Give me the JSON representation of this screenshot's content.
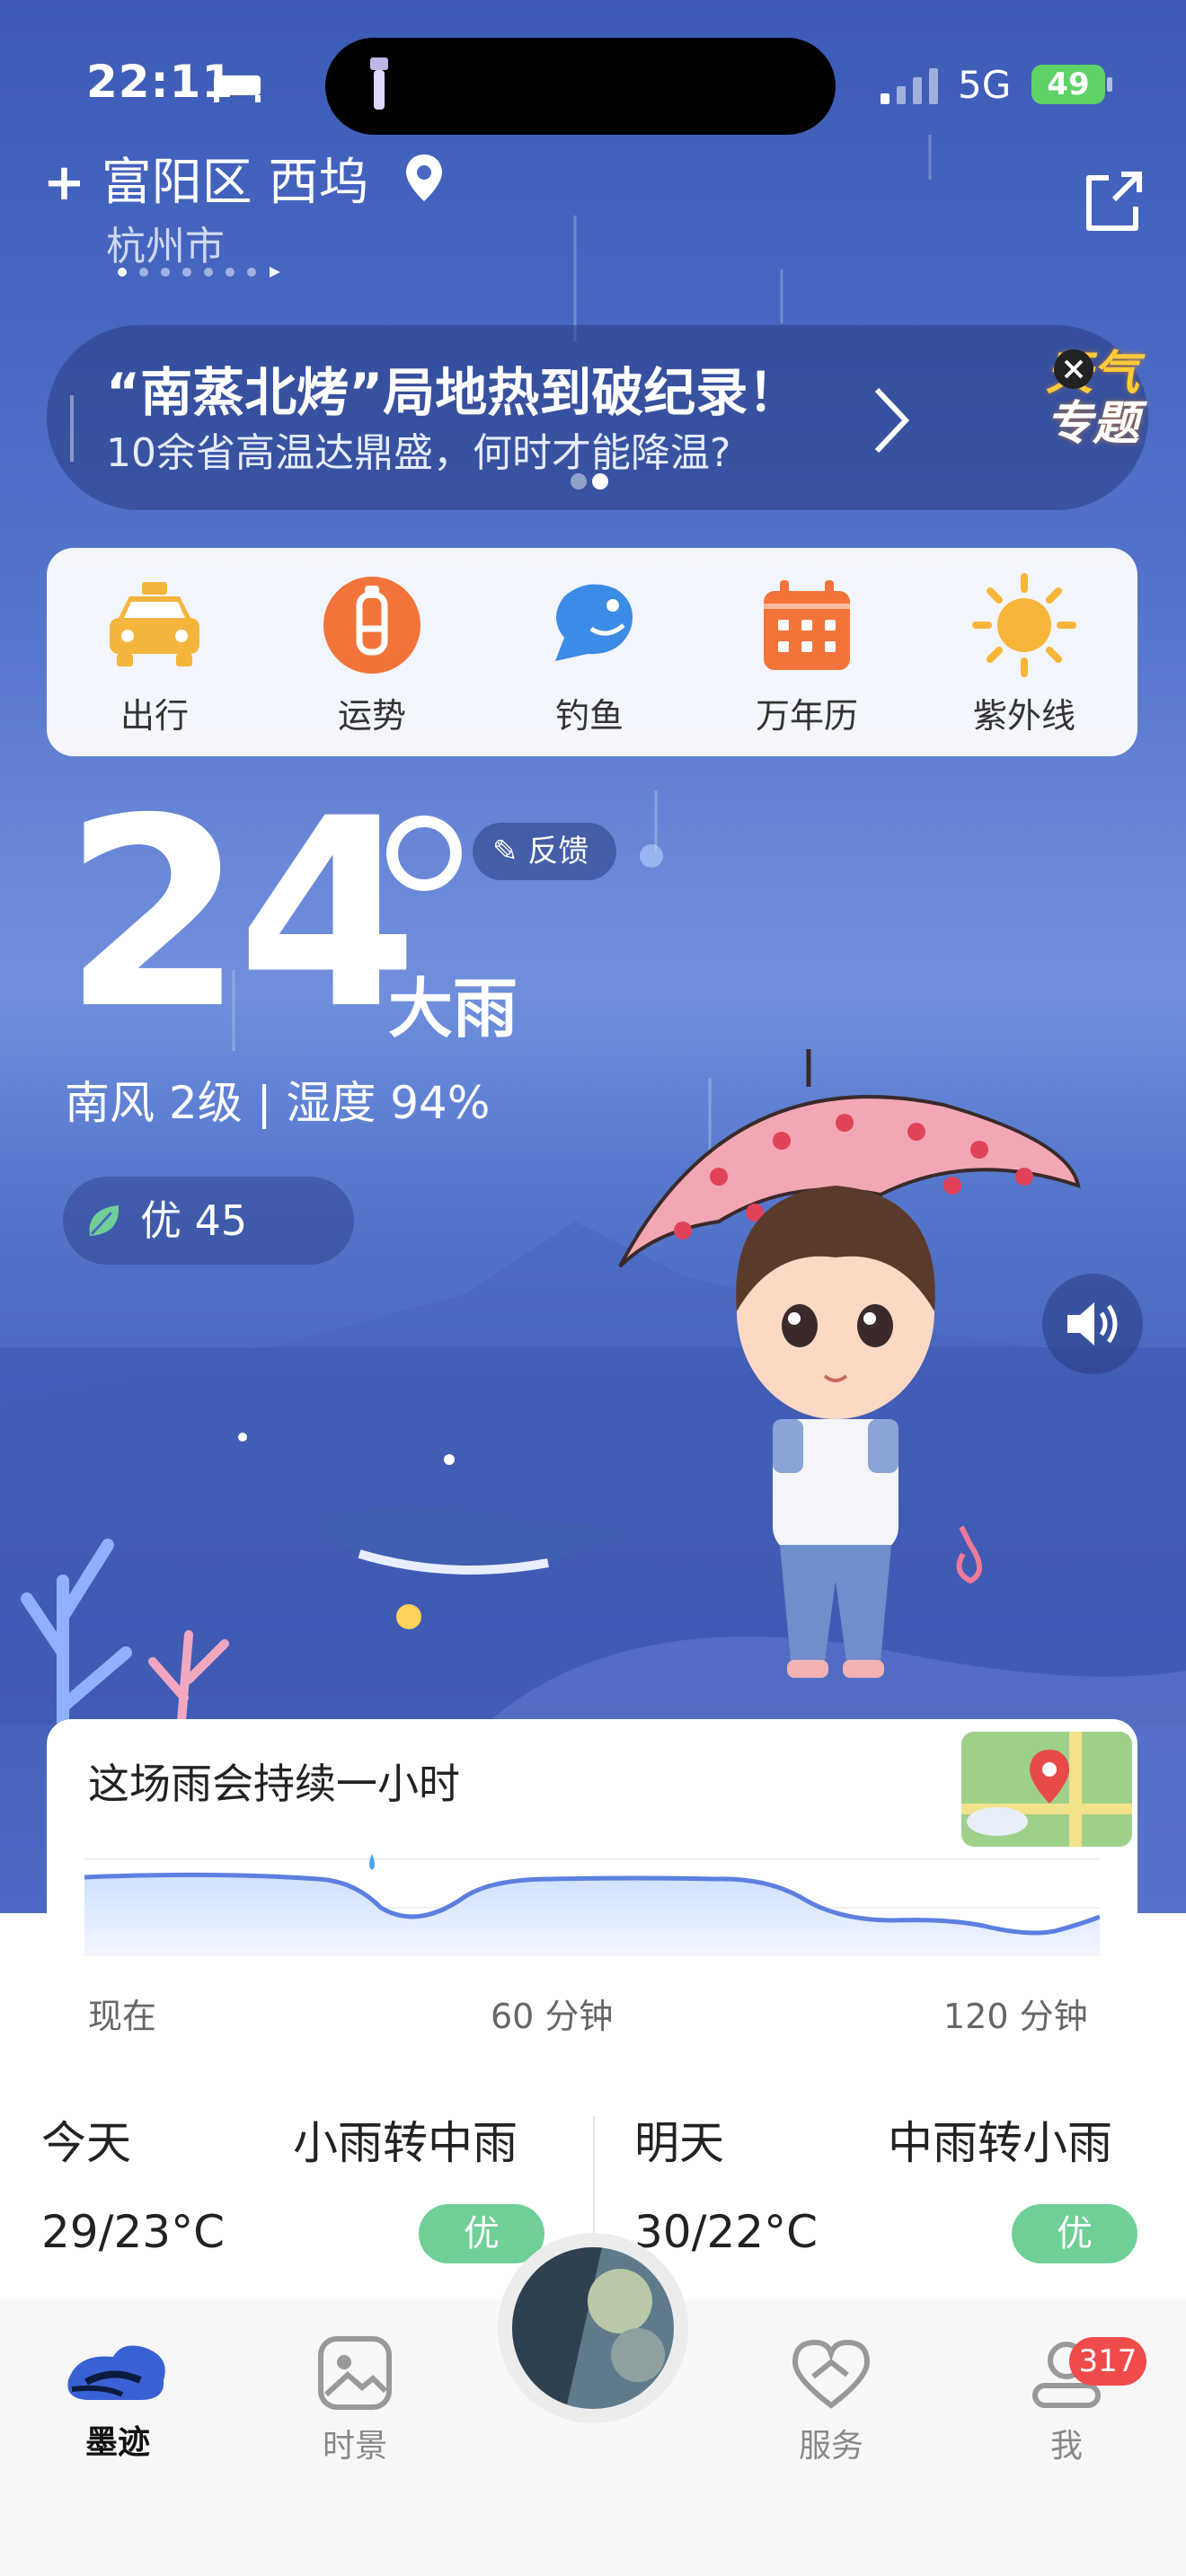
{
  "status_bar": {
    "time": "22:11",
    "network": "5G",
    "battery": "49"
  },
  "location": {
    "district": "富阳区 西坞",
    "city": "杭州市"
  },
  "banner": {
    "title": "“南蒸北烤”局地热到破纪录！",
    "subtitle": "10余省高温达鼎盛，何时才能降温?",
    "special_line1": "天气",
    "special_line2": "专题"
  },
  "tools": [
    {
      "label": "出行",
      "icon": "taxi-icon"
    },
    {
      "label": "运势",
      "icon": "fortune-icon"
    },
    {
      "label": "钓鱼",
      "icon": "fish-icon"
    },
    {
      "label": "万年历",
      "icon": "calendar-icon"
    },
    {
      "label": "紫外线",
      "icon": "sun-icon"
    }
  ],
  "current": {
    "temperature": "24",
    "condition": "大雨",
    "feedback": "反馈",
    "wind_humidity": "南风 2级 | 湿度 94%",
    "aqi": "优 45"
  },
  "rain": {
    "title": "这场雨会持续一小时",
    "labels": [
      "现在",
      "60 分钟",
      "120 分钟"
    ]
  },
  "forecast": {
    "today": {
      "day": "今天",
      "condition": "小雨转中雨",
      "temp": "29/23°C",
      "aqi": "优"
    },
    "tomorrow": {
      "day": "明天",
      "condition": "中雨转小雨",
      "temp": "30/22°C",
      "aqi": "优"
    }
  },
  "tabbar": {
    "items": [
      "墨迹",
      "时景",
      "服务",
      "我"
    ],
    "notification_count": "317"
  },
  "colors": {
    "accent": "#3b63d6",
    "aqi_good": "#6fcf97",
    "badge": "#f04b4b"
  }
}
